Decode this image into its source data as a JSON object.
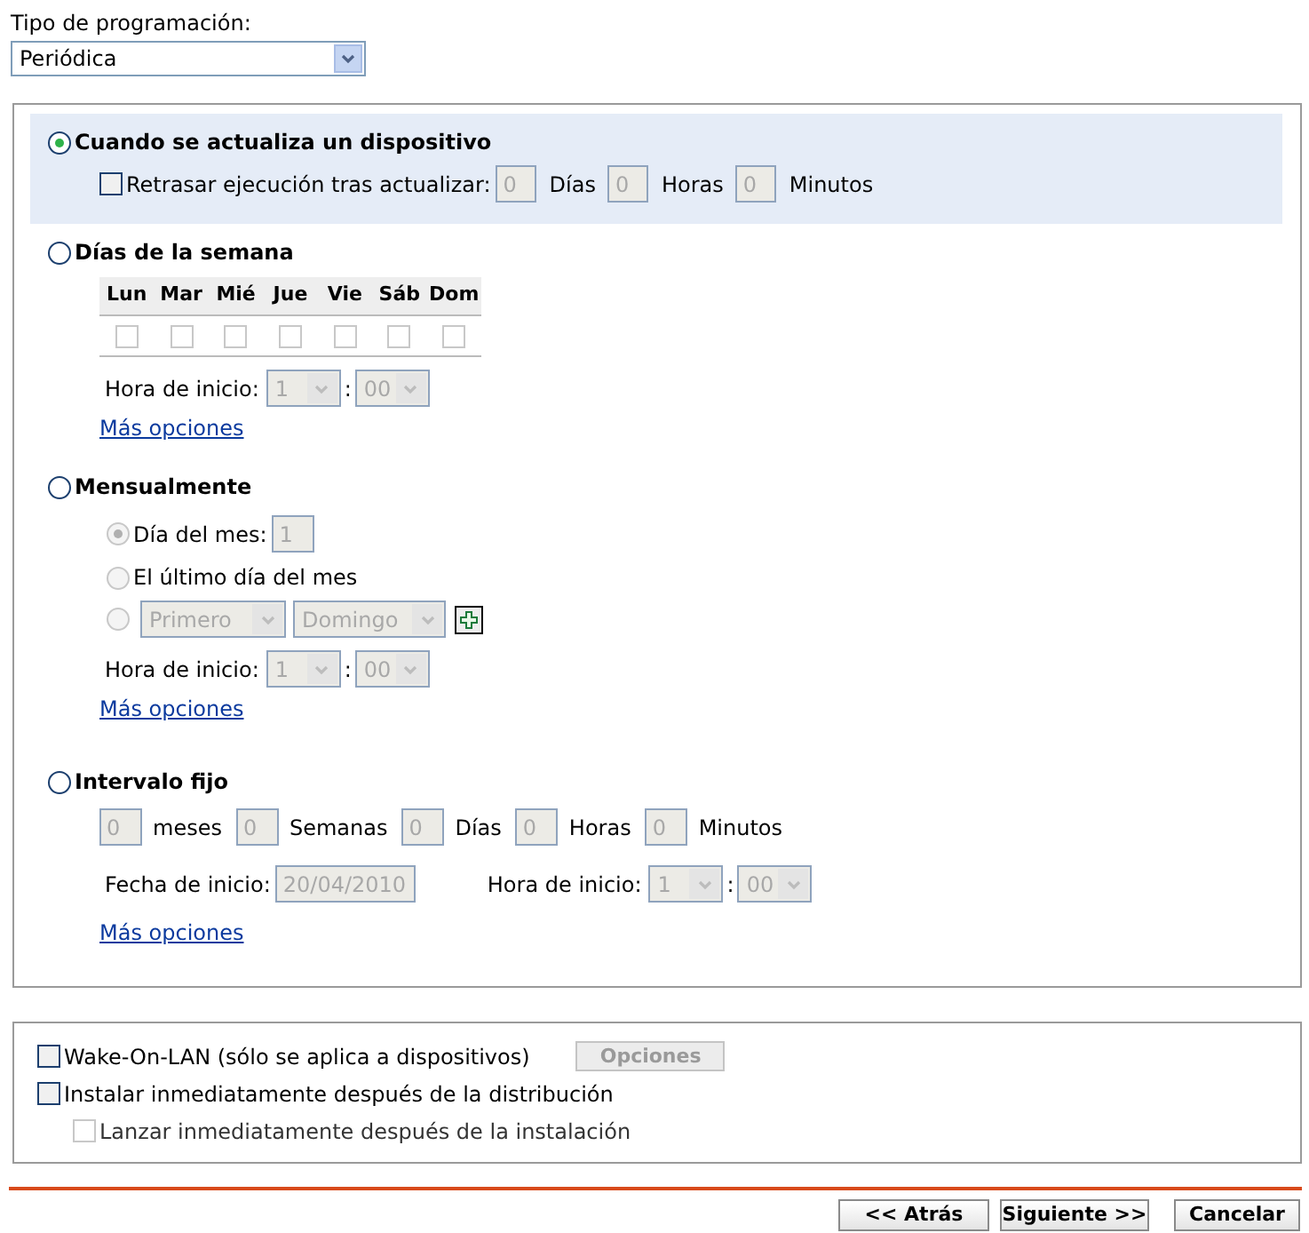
{
  "schedule_type": {
    "label": "Tipo de programación:",
    "value": "Periódica"
  },
  "options": [
    {
      "kind": "device_update",
      "label": "Cuando se actualiza un dispositivo",
      "selected": true,
      "delay": {
        "label": "Retrasar ejecución tras actualizar:",
        "checked": false,
        "fields": [
          {
            "value": "0",
            "unit": "Días"
          },
          {
            "value": "0",
            "unit": "Horas"
          },
          {
            "value": "0",
            "unit": "Minutos"
          }
        ]
      }
    },
    {
      "kind": "weekdays",
      "label": "Días de la semana",
      "selected": false,
      "days": [
        {
          "label": "Lun",
          "checked": false
        },
        {
          "label": "Mar",
          "checked": false
        },
        {
          "label": "Mié",
          "checked": false
        },
        {
          "label": "Jue",
          "checked": false
        },
        {
          "label": "Vie",
          "checked": false
        },
        {
          "label": "Sáb",
          "checked": false
        },
        {
          "label": "Dom",
          "checked": false
        }
      ],
      "start_time": {
        "label": "Hora de inicio:",
        "hour": "1",
        "separator": ":",
        "minute": "00"
      },
      "more_link": "Más opciones"
    },
    {
      "kind": "monthly",
      "label": "Mensualmente",
      "selected": false,
      "choices": [
        {
          "kind": "day_of_month",
          "label": "Día del mes:",
          "value": "1",
          "selected": true
        },
        {
          "kind": "last_day",
          "label": "El último día del mes",
          "selected": false
        },
        {
          "kind": "weekday_of_month",
          "ordinal": "Primero",
          "weekday": "Domingo",
          "selected": false
        }
      ],
      "start_time": {
        "label": "Hora de inicio:",
        "hour": "1",
        "separator": ":",
        "minute": "00"
      },
      "more_link": "Más opciones"
    },
    {
      "kind": "fixed_interval",
      "label": "Intervalo fijo",
      "selected": false,
      "fields": [
        {
          "value": "0",
          "unit": "meses"
        },
        {
          "value": "0",
          "unit": "Semanas"
        },
        {
          "value": "0",
          "unit": "Días"
        },
        {
          "value": "0",
          "unit": "Horas"
        },
        {
          "value": "0",
          "unit": "Minutos"
        }
      ],
      "start_date": {
        "label": "Fecha de inicio:",
        "value": "20/04/2010"
      },
      "start_time": {
        "label": "Hora de inicio:",
        "hour": "1",
        "separator": ":",
        "minute": "00"
      },
      "more_link": "Más opciones"
    }
  ],
  "extras": [
    {
      "label": "Wake-On-LAN (sólo se aplica a dispositivos)",
      "checked": false,
      "disabled": false,
      "button": "Opciones"
    },
    {
      "label": "Instalar inmediatamente después de la distribución",
      "checked": false,
      "disabled": false,
      "children": [
        {
          "label": "Lanzar inmediatamente después de la instalación",
          "checked": false,
          "disabled": true
        }
      ]
    }
  ],
  "buttons": [
    {
      "label": "<< Atrás"
    },
    {
      "label": "Siguiente >>"
    },
    {
      "label": "Cancelar"
    }
  ]
}
